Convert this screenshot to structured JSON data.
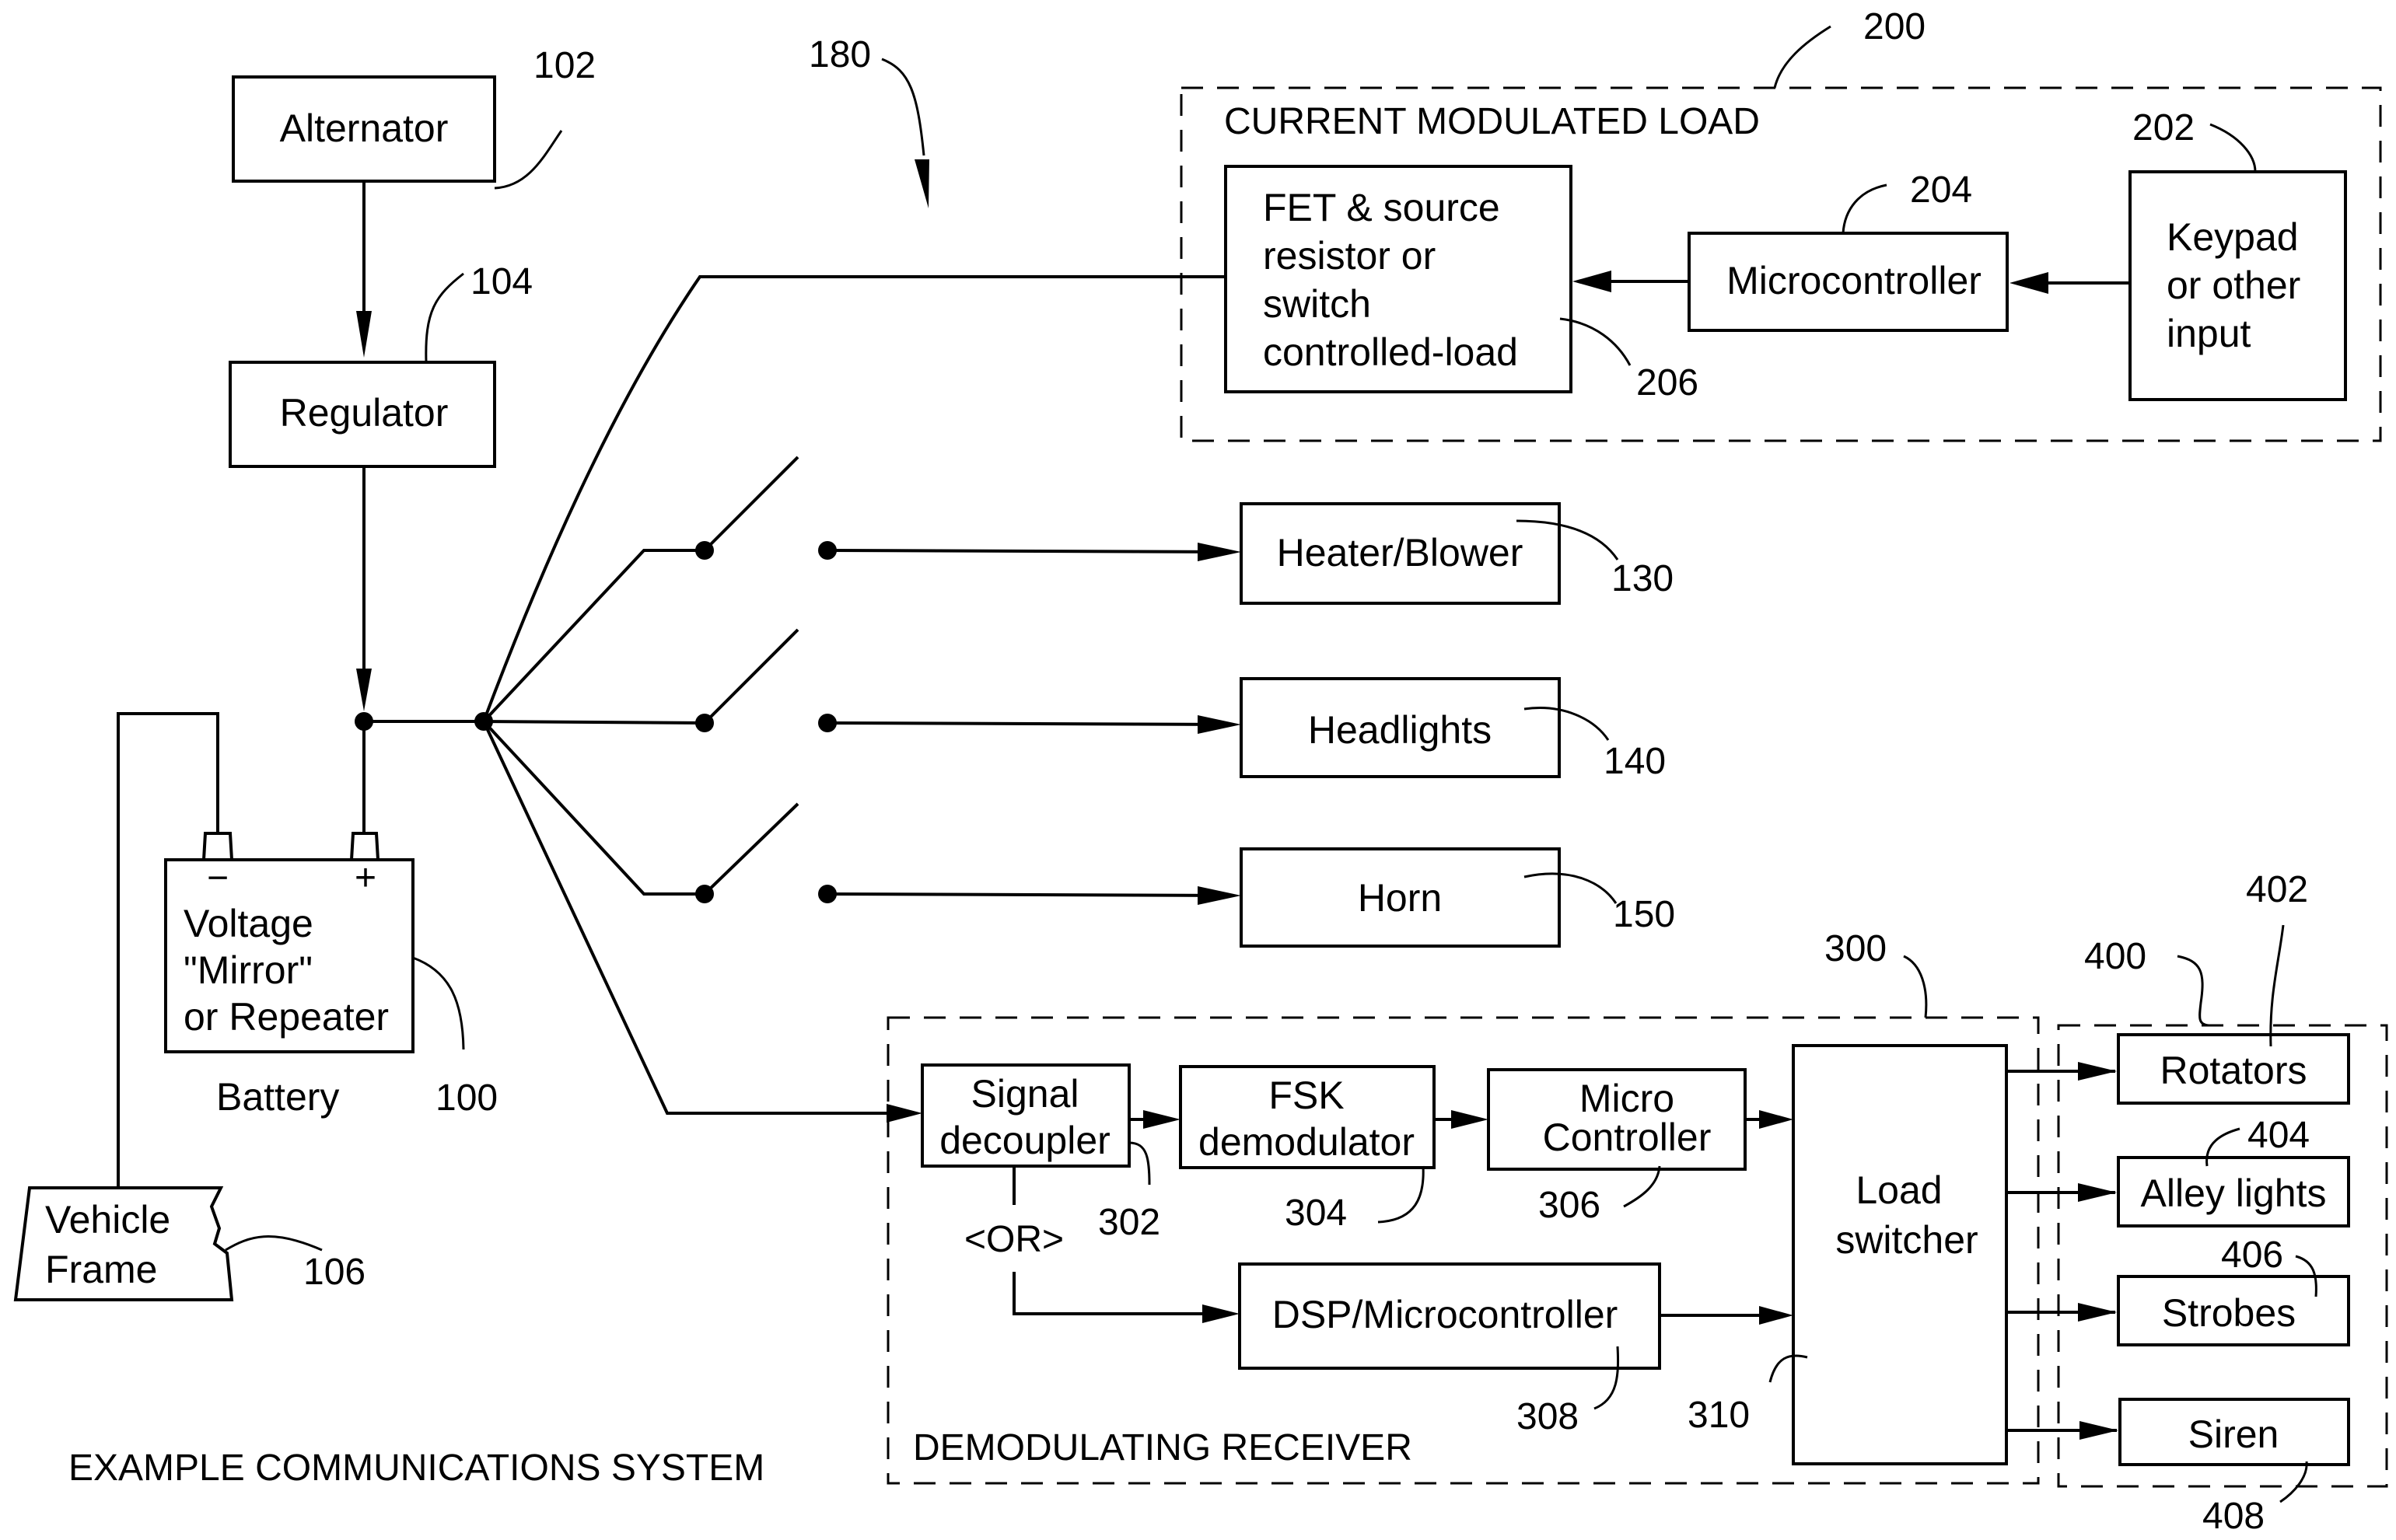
{
  "figure_title": "EXAMPLE COMMUNICATIONS SYSTEM",
  "power_source": {
    "alternator": {
      "label": "Alternator",
      "ref": "102"
    },
    "regulator": {
      "label": "Regulator",
      "ref": "104"
    },
    "battery": {
      "lines": [
        "Voltage",
        "\"Mirror\"",
        "or Repeater"
      ],
      "caption": "Battery",
      "ref": "100",
      "neg_terminal": "−",
      "pos_terminal": "+"
    },
    "vehicle_frame": {
      "lines": [
        "Vehicle",
        "Frame"
      ],
      "ref": "106"
    }
  },
  "bus_ref": "180",
  "switched_loads": [
    {
      "label": "Heater/Blower",
      "ref": "130"
    },
    {
      "label": "Headlights",
      "ref": "140"
    },
    {
      "label": "Horn",
      "ref": "150"
    }
  ],
  "current_modulated_load": {
    "title": "CURRENT MODULATED LOAD",
    "ref": "200",
    "fet": {
      "lines": [
        "FET & source",
        "resistor or",
        "switch",
        "controlled-load"
      ],
      "ref": "206"
    },
    "microcontroller": {
      "label": "Microcontroller",
      "ref": "204"
    },
    "keypad": {
      "lines": [
        "Keypad",
        "or other",
        "input"
      ],
      "ref": "202"
    }
  },
  "demodulating_receiver": {
    "title": "DEMODULATING RECEIVER",
    "ref": "300",
    "signal_decoupler": {
      "lines": [
        "Signal",
        "decoupler"
      ],
      "ref": "302"
    },
    "fsk_demodulator": {
      "lines": [
        "FSK",
        "demodulator"
      ],
      "ref": "304"
    },
    "micro_controller": {
      "lines": [
        "Micro",
        "Controller"
      ],
      "ref": "306"
    },
    "or_label": "<OR>",
    "dsp": {
      "label": "DSP/Microcontroller",
      "ref": "308"
    },
    "load_switcher": {
      "lines": [
        "Load",
        "switcher"
      ],
      "ref": "310"
    }
  },
  "emergency_loads": {
    "ref": "400",
    "items": [
      {
        "label": "Rotators",
        "ref": "402"
      },
      {
        "label": "Alley lights",
        "ref": "404"
      },
      {
        "label": "Strobes",
        "ref": "406"
      },
      {
        "label": "Siren",
        "ref": "408"
      }
    ]
  }
}
